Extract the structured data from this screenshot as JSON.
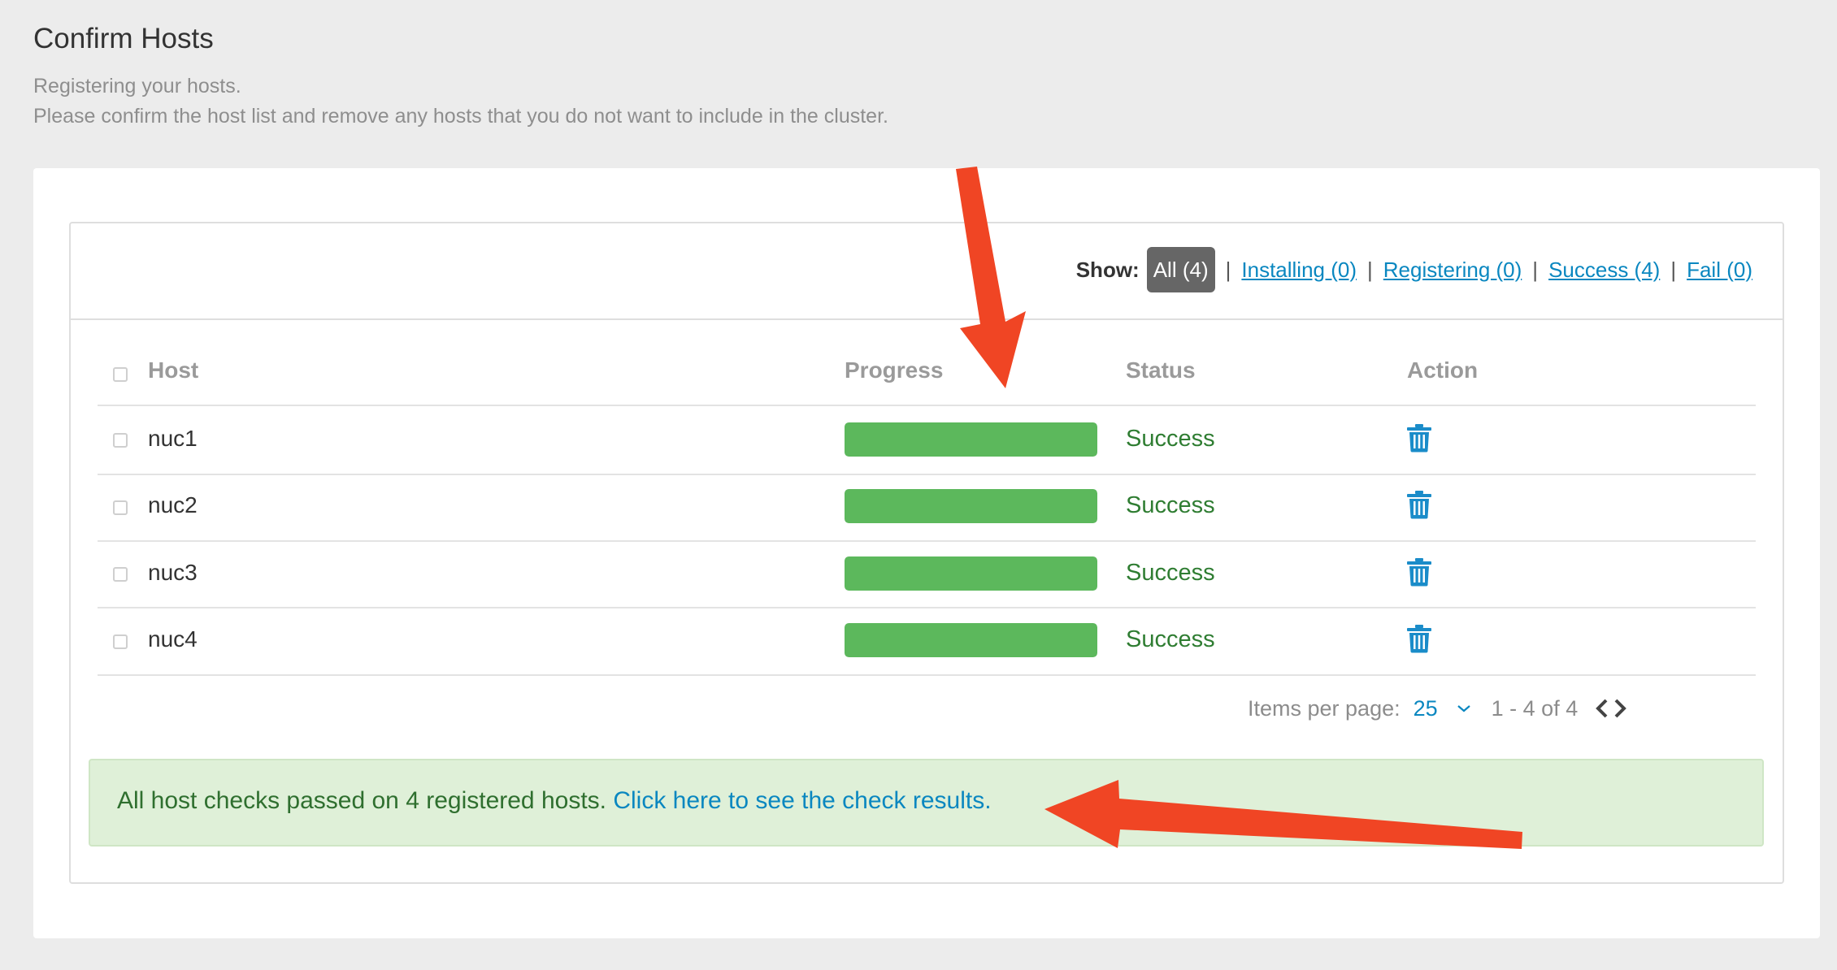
{
  "page": {
    "title": "Confirm Hosts",
    "subtitle_line1": "Registering your hosts.",
    "subtitle_line2": "Please confirm the host list and remove any hosts that you do not want to include in the cluster."
  },
  "filter": {
    "show_label": "Show:",
    "options": [
      "All (4)",
      "Installing (0)",
      "Registering (0)",
      "Success (4)",
      "Fail (0)"
    ],
    "active": "All (4)"
  },
  "table": {
    "columns": [
      "Host",
      "Progress",
      "Status",
      "Action"
    ],
    "rows": [
      {
        "host": "nuc1",
        "progress": 1.0,
        "status": "Success",
        "action_icon": "trash-icon"
      },
      {
        "host": "nuc2",
        "progress": 1.0,
        "status": "Success",
        "action_icon": "trash-icon"
      },
      {
        "host": "nuc3",
        "progress": 1.0,
        "status": "Success",
        "action_icon": "trash-icon"
      },
      {
        "host": "nuc4",
        "progress": 1.0,
        "status": "Success",
        "action_icon": "trash-icon"
      }
    ]
  },
  "pagination": {
    "items_per_page_label": "Items per page:",
    "items_per_page": "25",
    "range": "1 - 4 of 4"
  },
  "alert": {
    "message": "All host checks passed on 4 registered hosts.",
    "link": "Click here to see the check results."
  },
  "colors": {
    "success_bar": "#5cb85c",
    "success_text": "#2f7d32",
    "link": "#0a87c0",
    "alert_bg": "#dff0d8",
    "annotation_arrow": "#f04524"
  }
}
